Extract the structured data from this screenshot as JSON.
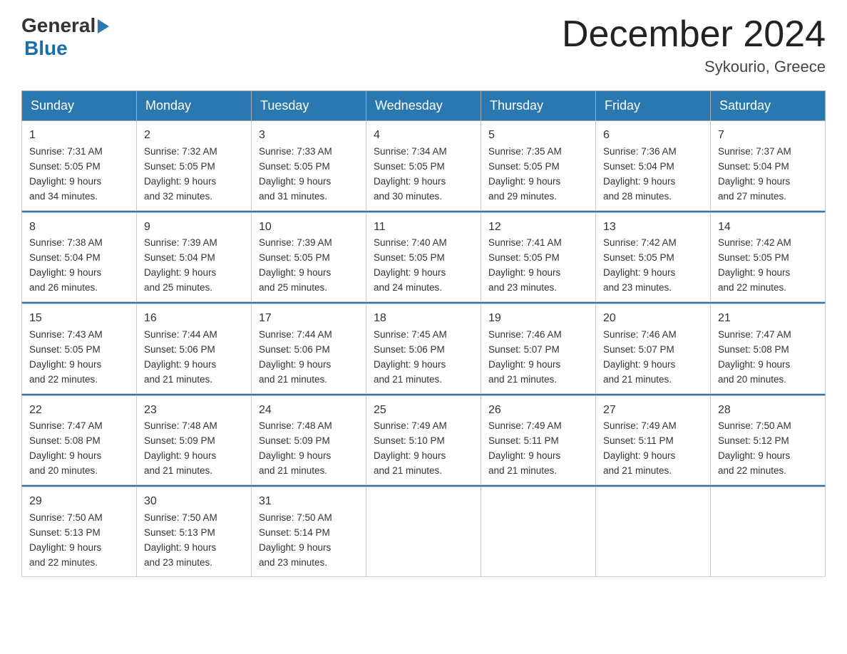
{
  "logo": {
    "general": "General",
    "blue": "Blue"
  },
  "title": "December 2024",
  "location": "Sykourio, Greece",
  "days": [
    "Sunday",
    "Monday",
    "Tuesday",
    "Wednesday",
    "Thursday",
    "Friday",
    "Saturday"
  ],
  "weeks": [
    [
      {
        "num": "1",
        "sunrise": "7:31 AM",
        "sunset": "5:05 PM",
        "daylight": "9 hours and 34 minutes."
      },
      {
        "num": "2",
        "sunrise": "7:32 AM",
        "sunset": "5:05 PM",
        "daylight": "9 hours and 32 minutes."
      },
      {
        "num": "3",
        "sunrise": "7:33 AM",
        "sunset": "5:05 PM",
        "daylight": "9 hours and 31 minutes."
      },
      {
        "num": "4",
        "sunrise": "7:34 AM",
        "sunset": "5:05 PM",
        "daylight": "9 hours and 30 minutes."
      },
      {
        "num": "5",
        "sunrise": "7:35 AM",
        "sunset": "5:05 PM",
        "daylight": "9 hours and 29 minutes."
      },
      {
        "num": "6",
        "sunrise": "7:36 AM",
        "sunset": "5:04 PM",
        "daylight": "9 hours and 28 minutes."
      },
      {
        "num": "7",
        "sunrise": "7:37 AM",
        "sunset": "5:04 PM",
        "daylight": "9 hours and 27 minutes."
      }
    ],
    [
      {
        "num": "8",
        "sunrise": "7:38 AM",
        "sunset": "5:04 PM",
        "daylight": "9 hours and 26 minutes."
      },
      {
        "num": "9",
        "sunrise": "7:39 AM",
        "sunset": "5:04 PM",
        "daylight": "9 hours and 25 minutes."
      },
      {
        "num": "10",
        "sunrise": "7:39 AM",
        "sunset": "5:05 PM",
        "daylight": "9 hours and 25 minutes."
      },
      {
        "num": "11",
        "sunrise": "7:40 AM",
        "sunset": "5:05 PM",
        "daylight": "9 hours and 24 minutes."
      },
      {
        "num": "12",
        "sunrise": "7:41 AM",
        "sunset": "5:05 PM",
        "daylight": "9 hours and 23 minutes."
      },
      {
        "num": "13",
        "sunrise": "7:42 AM",
        "sunset": "5:05 PM",
        "daylight": "9 hours and 23 minutes."
      },
      {
        "num": "14",
        "sunrise": "7:42 AM",
        "sunset": "5:05 PM",
        "daylight": "9 hours and 22 minutes."
      }
    ],
    [
      {
        "num": "15",
        "sunrise": "7:43 AM",
        "sunset": "5:05 PM",
        "daylight": "9 hours and 22 minutes."
      },
      {
        "num": "16",
        "sunrise": "7:44 AM",
        "sunset": "5:06 PM",
        "daylight": "9 hours and 21 minutes."
      },
      {
        "num": "17",
        "sunrise": "7:44 AM",
        "sunset": "5:06 PM",
        "daylight": "9 hours and 21 minutes."
      },
      {
        "num": "18",
        "sunrise": "7:45 AM",
        "sunset": "5:06 PM",
        "daylight": "9 hours and 21 minutes."
      },
      {
        "num": "19",
        "sunrise": "7:46 AM",
        "sunset": "5:07 PM",
        "daylight": "9 hours and 21 minutes."
      },
      {
        "num": "20",
        "sunrise": "7:46 AM",
        "sunset": "5:07 PM",
        "daylight": "9 hours and 21 minutes."
      },
      {
        "num": "21",
        "sunrise": "7:47 AM",
        "sunset": "5:08 PM",
        "daylight": "9 hours and 20 minutes."
      }
    ],
    [
      {
        "num": "22",
        "sunrise": "7:47 AM",
        "sunset": "5:08 PM",
        "daylight": "9 hours and 20 minutes."
      },
      {
        "num": "23",
        "sunrise": "7:48 AM",
        "sunset": "5:09 PM",
        "daylight": "9 hours and 21 minutes."
      },
      {
        "num": "24",
        "sunrise": "7:48 AM",
        "sunset": "5:09 PM",
        "daylight": "9 hours and 21 minutes."
      },
      {
        "num": "25",
        "sunrise": "7:49 AM",
        "sunset": "5:10 PM",
        "daylight": "9 hours and 21 minutes."
      },
      {
        "num": "26",
        "sunrise": "7:49 AM",
        "sunset": "5:11 PM",
        "daylight": "9 hours and 21 minutes."
      },
      {
        "num": "27",
        "sunrise": "7:49 AM",
        "sunset": "5:11 PM",
        "daylight": "9 hours and 21 minutes."
      },
      {
        "num": "28",
        "sunrise": "7:50 AM",
        "sunset": "5:12 PM",
        "daylight": "9 hours and 22 minutes."
      }
    ],
    [
      {
        "num": "29",
        "sunrise": "7:50 AM",
        "sunset": "5:13 PM",
        "daylight": "9 hours and 22 minutes."
      },
      {
        "num": "30",
        "sunrise": "7:50 AM",
        "sunset": "5:13 PM",
        "daylight": "9 hours and 23 minutes."
      },
      {
        "num": "31",
        "sunrise": "7:50 AM",
        "sunset": "5:14 PM",
        "daylight": "9 hours and 23 minutes."
      },
      null,
      null,
      null,
      null
    ]
  ]
}
